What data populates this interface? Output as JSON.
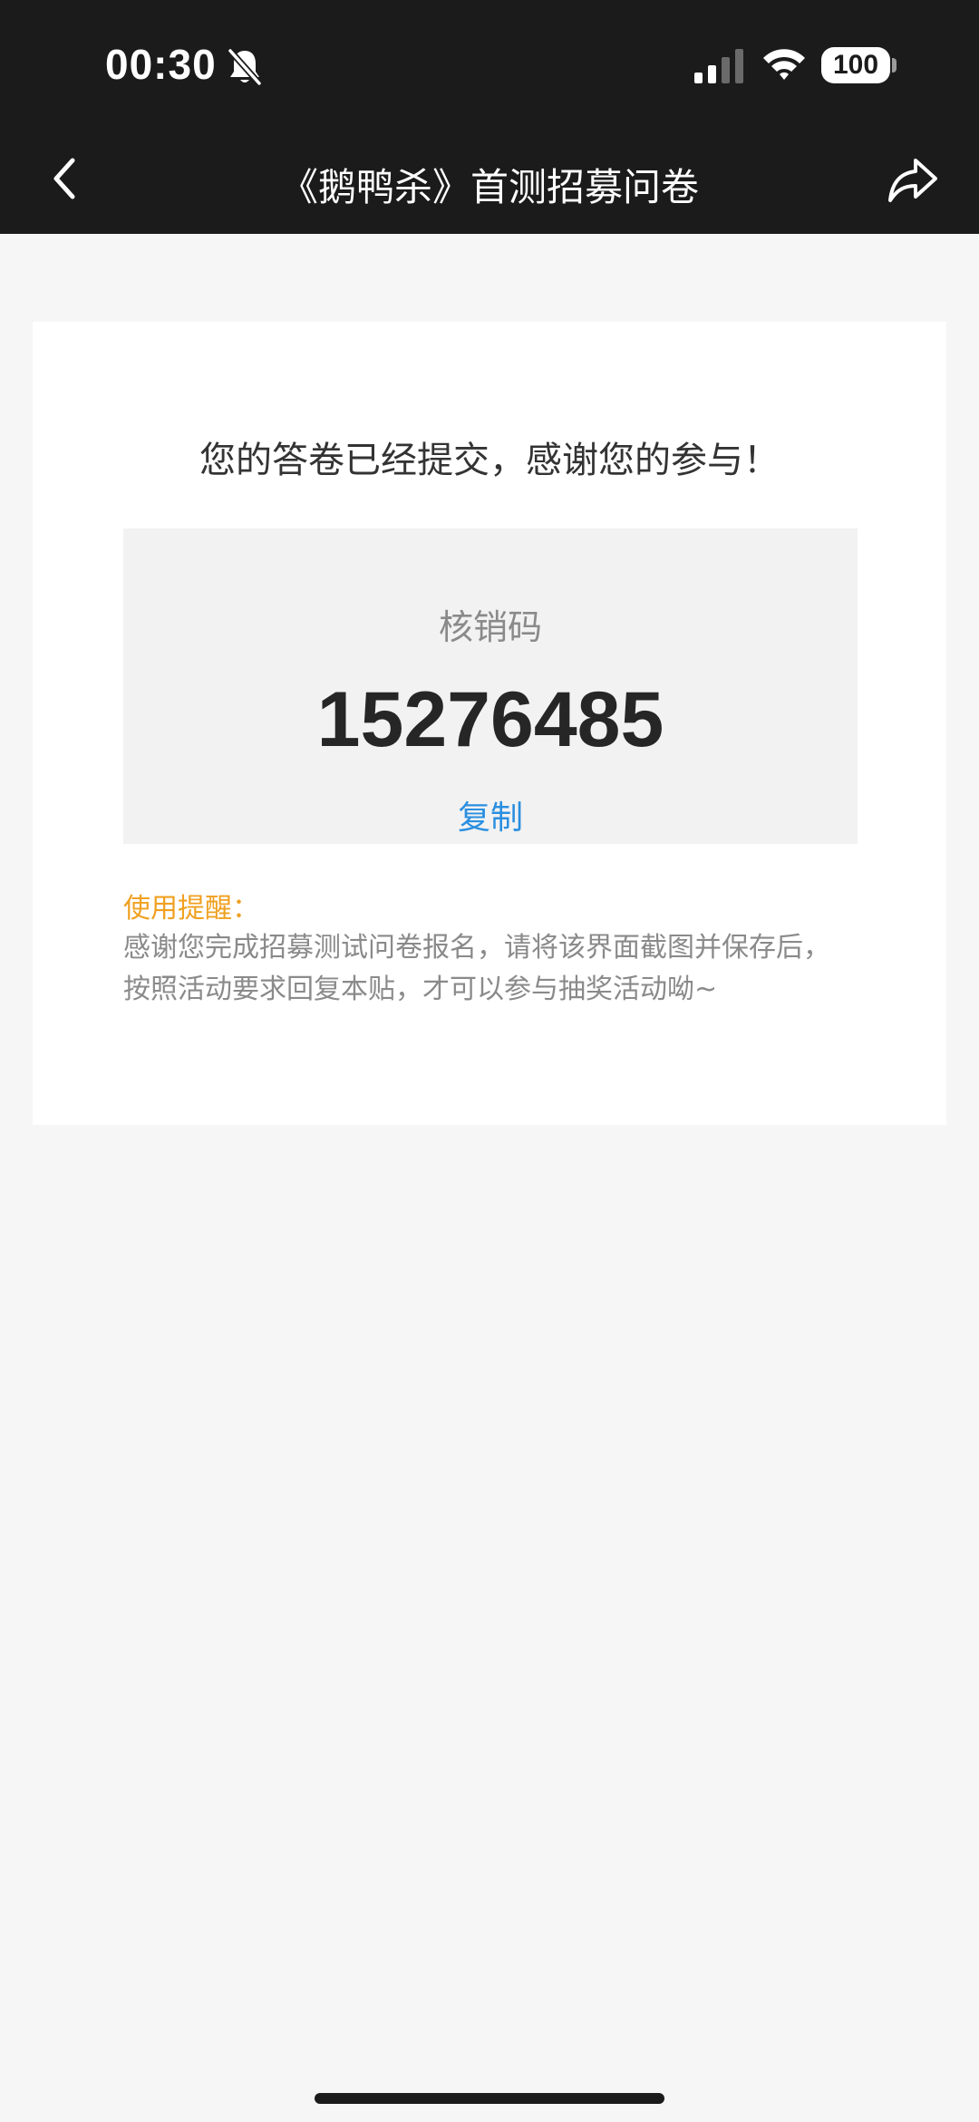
{
  "status_bar": {
    "time": "00:30",
    "battery": "100",
    "icons": [
      "bell-muted-icon",
      "signal-icon",
      "wifi-icon",
      "battery-icon"
    ]
  },
  "nav": {
    "title": "《鹅鸭杀》首测招募问卷",
    "back_icon": "chevron-left-icon",
    "share_icon": "share-icon"
  },
  "card": {
    "success_message": "您的答卷已经提交，感谢您的参与！",
    "code_label": "核销码",
    "code_value": "15276485",
    "copy_label": "复制",
    "reminder_title": "使用提醒：",
    "reminder_line1": "感谢您完成招募测试问卷报名，请将该界面截图并保存后，",
    "reminder_line2": "按照活动要求回复本贴，才可以参与抽奖活动呦~"
  },
  "colors": {
    "bar_bg": "#1b1b1b",
    "page_bg": "#f6f6f6",
    "link_blue": "#2b8fe0",
    "reminder_orange": "#f0a020"
  }
}
